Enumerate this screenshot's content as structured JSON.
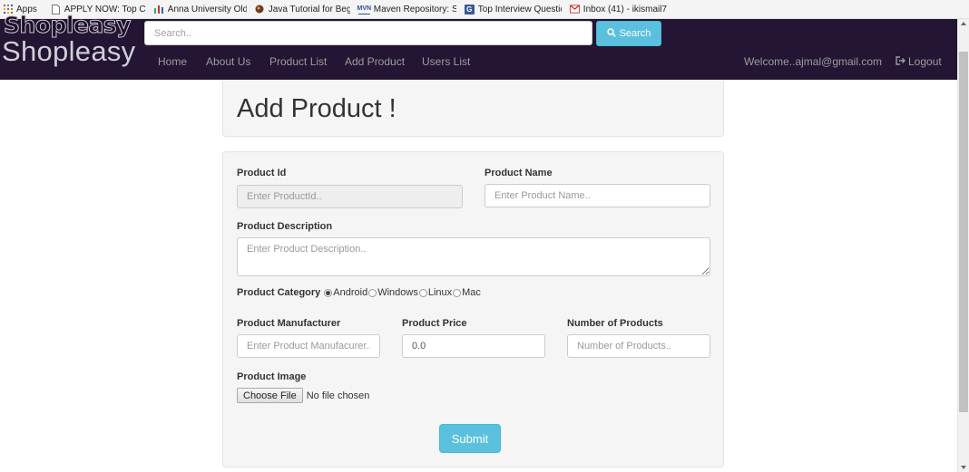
{
  "bookmarks": [
    {
      "label": "Apps",
      "icon": "apps-grid-icon"
    },
    {
      "label": "APPLY NOW: Top Cor",
      "icon": "page-icon"
    },
    {
      "label": "Anna University Old U",
      "icon": "bars-icon"
    },
    {
      "label": "Java Tutorial for Begin",
      "icon": "coffee-icon"
    },
    {
      "label": "Maven Repository: Se",
      "icon": "mvn-icon"
    },
    {
      "label": "Top Interview Questic",
      "icon": "g-icon"
    },
    {
      "label": "Inbox (41) - ikismail7",
      "icon": "gmail-icon"
    }
  ],
  "navbar": {
    "brand_bold": "Shopleasy",
    "brand": "Shopleasy",
    "search_placeholder": "Search..",
    "search_button": "Search",
    "links": [
      "Home",
      "About Us",
      "Product List",
      "Add Product",
      "Users List"
    ],
    "welcome": "Welcome..ajmal@gmail.com",
    "logout": "Logout"
  },
  "page": {
    "title": "Add Product !"
  },
  "form": {
    "product_id": {
      "label": "Product Id",
      "placeholder": "Enter ProductId.."
    },
    "product_name": {
      "label": "Product Name",
      "placeholder": "Enter Product Name.."
    },
    "product_description": {
      "label": "Product Description",
      "placeholder": "Enter Product Description.."
    },
    "product_category": {
      "label": "Product Category",
      "options": [
        "Android",
        "Windows",
        "Linux",
        "Mac"
      ],
      "selected": "Android"
    },
    "product_manufacturer": {
      "label": "Product Manufacturer",
      "placeholder": "Enter Product Manufacurer.."
    },
    "product_price": {
      "label": "Product Price",
      "value": "0.0"
    },
    "number_of_products": {
      "label": "Number of Products",
      "placeholder": "Number of Products.."
    },
    "product_image": {
      "label": "Product Image",
      "button": "Choose File",
      "status": "No file chosen"
    },
    "submit": "Submit"
  },
  "colors": {
    "navbar_bg": "#231533",
    "accent": "#5bc0de",
    "panel_bg": "#f5f5f5"
  }
}
